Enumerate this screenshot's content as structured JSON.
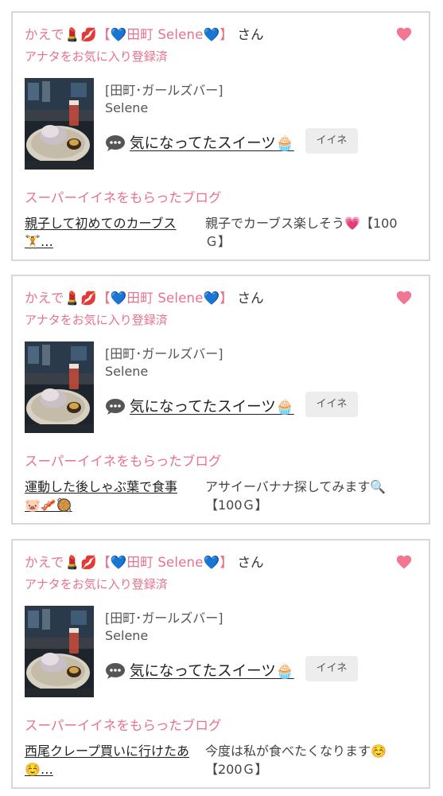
{
  "cards": [
    {
      "name_prefix": "かえで💄💋【💙田町 Selene💙】",
      "name_suffix": "さん",
      "favorite_status": "アナタをお気に入り登録済",
      "shop": "[田町･ガールズバー]",
      "girl_name": "Selene",
      "post_title": "気になってたスイーツ🧁",
      "iine_label": "イイネ",
      "super_label": "スーパーイイネをもらったブログ",
      "blog_title": "親子して初めてのカーブス🏋️…",
      "blog_comment": "親子でカーブス楽しそう💗【100Ｇ】"
    },
    {
      "name_prefix": "かえで💄💋【💙田町 Selene💙】",
      "name_suffix": "さん",
      "favorite_status": "アナタをお気に入り登録済",
      "shop": "[田町･ガールズバー]",
      "girl_name": "Selene",
      "post_title": "気になってたスイーツ🧁",
      "iine_label": "イイネ",
      "super_label": "スーパーイイネをもらったブログ",
      "blog_title": "運動した後しゃぶ葉で食事🐷🥓🥘",
      "blog_comment": "アサイーバナナ探してみます🔍【100Ｇ】"
    },
    {
      "name_prefix": "かえで💄💋【💙田町 Selene💙】",
      "name_suffix": "さん",
      "favorite_status": "アナタをお気に入り登録済",
      "shop": "[田町･ガールズバー]",
      "girl_name": "Selene",
      "post_title": "気になってたスイーツ🧁",
      "iine_label": "イイネ",
      "super_label": "スーパーイイネをもらったブログ",
      "blog_title": "西尾クレープ買いに行けたあ☺️…",
      "blog_comment": "今度は私が食べたくなります☺️【200Ｇ】"
    }
  ],
  "colors": {
    "accent": "#e8718e",
    "border": "#d8d8d8",
    "button_bg": "#ededed"
  },
  "icons": {
    "favorite": "heart-icon",
    "speech": "speech-bubble-icon"
  }
}
